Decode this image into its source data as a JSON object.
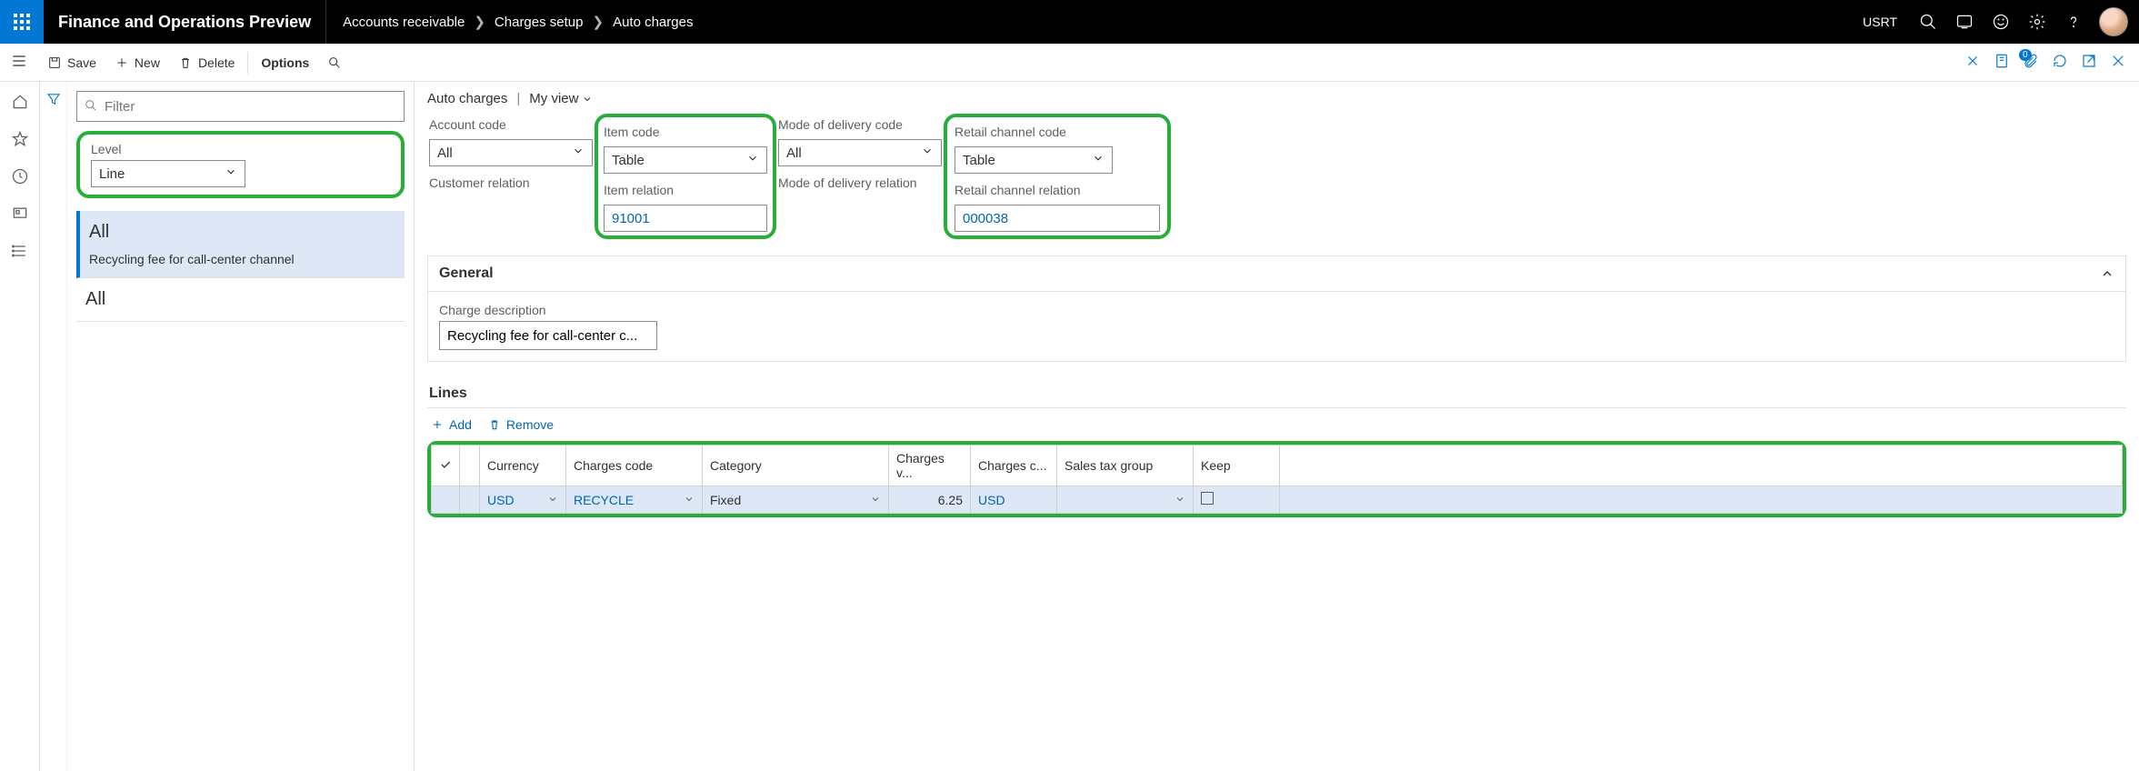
{
  "topbar": {
    "app_title": "Finance and Operations Preview",
    "breadcrumb": [
      "Accounts receivable",
      "Charges setup",
      "Auto charges"
    ],
    "entity": "USRT"
  },
  "actions": {
    "save": "Save",
    "new": "New",
    "delete": "Delete",
    "options": "Options",
    "attachments_count": "0"
  },
  "filter": {
    "placeholder": "Filter"
  },
  "level": {
    "label": "Level",
    "value": "Line"
  },
  "list": {
    "items": [
      {
        "primary": "All",
        "secondary": "Recycling fee for call-center channel",
        "selected": true
      },
      {
        "primary": "All",
        "secondary": "",
        "selected": false
      }
    ]
  },
  "main": {
    "title": "Auto charges",
    "view_label": "My view",
    "header": {
      "account_code": {
        "label": "Account code",
        "value": "All"
      },
      "customer_relation": {
        "label": "Customer relation",
        "value": ""
      },
      "item_code": {
        "label": "Item code",
        "value": "Table"
      },
      "item_relation": {
        "label": "Item relation",
        "value": "91001"
      },
      "mode_delivery_code": {
        "label": "Mode of delivery code",
        "value": "All"
      },
      "mode_delivery_relation": {
        "label": "Mode of delivery relation",
        "value": ""
      },
      "retail_channel_code": {
        "label": "Retail channel code",
        "value": "Table"
      },
      "retail_channel_relation": {
        "label": "Retail channel relation",
        "value": "000038"
      }
    },
    "general": {
      "title": "General",
      "charge_desc_label": "Charge description",
      "charge_desc_value": "Recycling fee for call-center c..."
    },
    "lines": {
      "title": "Lines",
      "add": "Add",
      "remove": "Remove",
      "columns": [
        "Currency",
        "Charges code",
        "Category",
        "Charges v...",
        "Charges c...",
        "Sales tax group",
        "Keep"
      ],
      "rows": [
        {
          "currency": "USD",
          "charges_code": "RECYCLE",
          "category": "Fixed",
          "charges_value": "6.25",
          "charges_currency": "USD",
          "sales_tax_group": "",
          "keep": false
        }
      ]
    }
  }
}
